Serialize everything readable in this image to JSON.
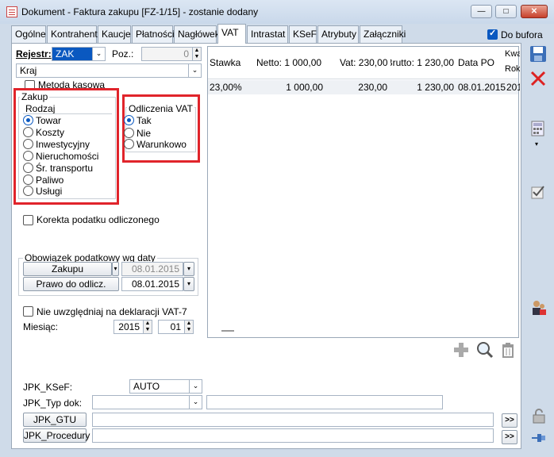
{
  "window": {
    "title": "Dokument - Faktura zakupu [FZ-1/15]  - zostanie dodany",
    "min": "—",
    "max": "□",
    "close": "✕"
  },
  "tabs": [
    "Ogólne",
    "Kontrahent",
    "Kaucje",
    "Płatności",
    "Nagłówek",
    "VAT",
    "Intrastat",
    "KSeF",
    "Atrybuty",
    "Załączniki"
  ],
  "do_bufora": "Do bufora",
  "rejestr": {
    "label": "Rejestr:",
    "value": "ZAK",
    "poz_label": "Poz.:",
    "poz_value": "0",
    "kraj": "Kraj"
  },
  "metoda_kasowa": "Metoda kasowa",
  "zakup": {
    "title": "Zakup",
    "rodzaj": "Rodzaj",
    "options": [
      "Towar",
      "Koszty",
      "Inwestycyjny",
      "Nieruchomości",
      "Śr. transportu",
      "Paliwo",
      "Usługi"
    ]
  },
  "odliczenia": {
    "title": "Odliczenia VAT",
    "options": [
      "Tak",
      "Nie",
      "Warunkowo"
    ]
  },
  "korekta": "Korekta podatku odliczonego",
  "obowiazek": {
    "title": "Obowiązek podatkowy wg daty",
    "zakupu_btn": "Zakupu",
    "zakupu_date": "08.01.2015",
    "prawo_btn": "Prawo do odlicz.",
    "prawo_date": "08.01.2015"
  },
  "nie_uwzgledniaj": "Nie uwzględniaj na deklaracji VAT-7",
  "miesiac": {
    "label": "Miesiąc:",
    "year": "2015",
    "month": "01"
  },
  "vat_table": {
    "headers": [
      "Stawka",
      "Netto: 1 000,00",
      "Vat: 230,00",
      "Brutto: 1 230,00",
      "Data PO",
      "Kwalifikacja",
      "Rok"
    ],
    "row": [
      "23,00%",
      "1 000,00",
      "230,00",
      "1 230,00",
      "08.01.2015",
      "201"
    ]
  },
  "jpk": {
    "ksef_label": "JPK_KSeF:",
    "ksef_value": "AUTO",
    "typ_label": "JPK_Typ dok:",
    "gtu_btn": "JPK_GTU",
    "procedury_btn": "JPK_Procedury",
    "arrow": ">>"
  }
}
